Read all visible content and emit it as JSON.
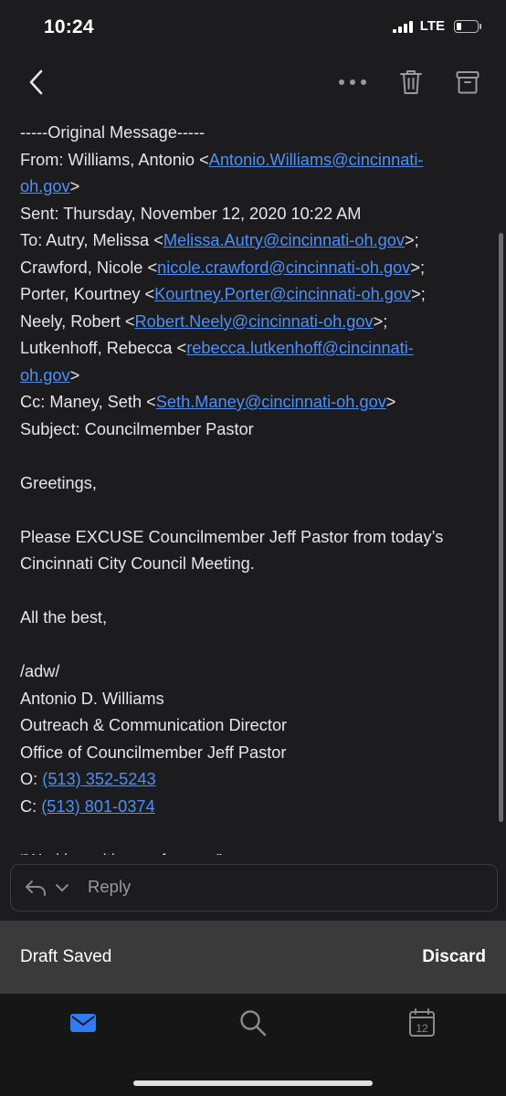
{
  "status_bar": {
    "time": "10:24",
    "network": "LTE",
    "battery_level_pct": 25
  },
  "toolbar": {
    "back_icon": "chevron-left-icon",
    "more_icon": "more-horizontal-icon",
    "delete_icon": "trash-icon",
    "archive_icon": "archive-icon"
  },
  "email": {
    "header_line": "-----Original Message-----",
    "from_label": "From: Williams, Antonio <",
    "from_email_a": "Antonio.Williams@cincinnati-",
    "from_email_b": "oh.gov",
    "sent": "Sent: Thursday, November 12, 2020 10:22 AM",
    "to_label": "To: Autry, Melissa <",
    "to_email": "Melissa.Autry@cincinnati-oh.gov",
    "cc_person_1": "Crawford, Nicole <",
    "cc_email_1": "nicole.crawford@cincinnati-oh.gov",
    "cc_person_2": "Porter, Kourtney <",
    "cc_email_2": "Kourtney.Porter@cincinnati-oh.gov",
    "cc_person_3": "Neely, Robert <",
    "cc_email_3": "Robert.Neely@cincinnati-oh.gov",
    "cc_person_4": "Lutkenhoff, Rebecca <",
    "cc_email_4a": "rebecca.lutkenhoff@cincinnati-",
    "cc_email_4b": "oh.gov",
    "cc_label": "Cc: Maney, Seth <",
    "cc_email": "Seth.Maney@cincinnati-oh.gov",
    "subject": "Subject: Councilmember Pastor",
    "greeting": "Greetings,",
    "body_1": "Please EXCUSE Councilmember Jeff Pastor from today’s",
    "body_2": "Cincinnati City Council Meeting.",
    "closing": "All the best,",
    "sig_initials": "/adw/",
    "sig_name": "Antonio D. Williams",
    "sig_title": "Outreach & Communication Director",
    "sig_office": "Office of Councilmember Jeff Pastor",
    "office_label": "O: ",
    "office_phone": "(513) 352-5243",
    "cell_label": "C: ",
    "cell_phone": "(513) 801-0374",
    "motto": "“Working with you; for you.”"
  },
  "reply": {
    "label": "Reply"
  },
  "draft_bar": {
    "status": "Draft Saved",
    "discard_label": "Discard"
  },
  "tab_bar": {
    "calendar_day": "12",
    "accent": "#2f7bf5"
  },
  "colors": {
    "background": "#1c1c1e",
    "link": "#4f8ff7",
    "draft_bar": "#3a3a3a"
  }
}
